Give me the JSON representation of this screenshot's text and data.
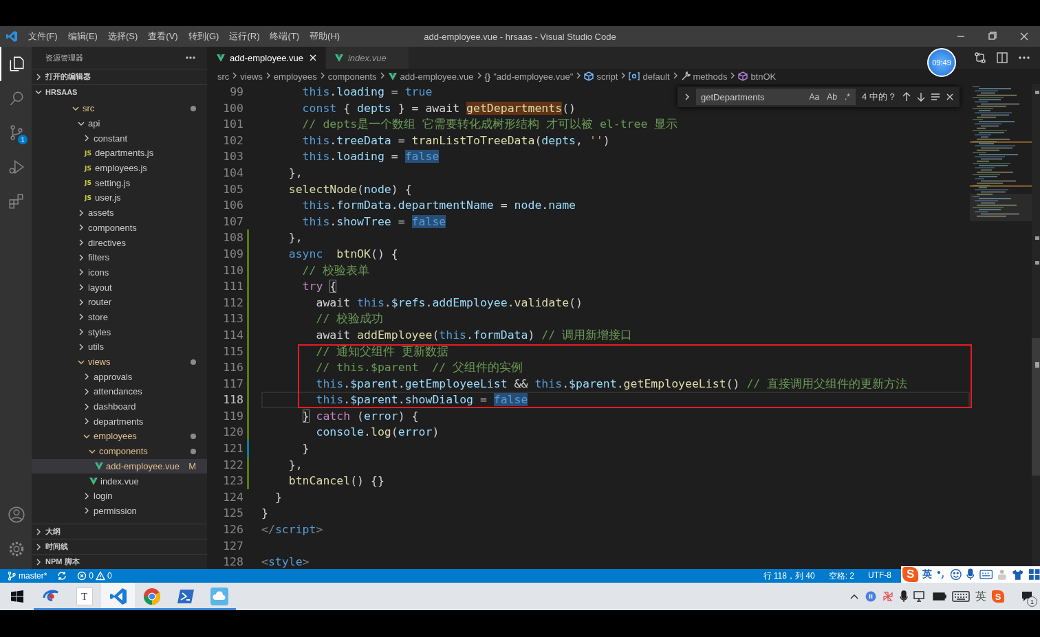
{
  "window": {
    "title": "add-employee.vue - hrsaas - Visual Studio Code",
    "menus": [
      "文件(F)",
      "编辑(E)",
      "选择(S)",
      "查看(V)",
      "转到(G)",
      "运行(R)",
      "终端(T)",
      "帮助(H)"
    ]
  },
  "activity_bar": {
    "items": [
      {
        "kind": "explorer",
        "selected": true
      },
      {
        "kind": "search",
        "selected": false
      },
      {
        "kind": "source-control",
        "selected": false,
        "badge": "1"
      },
      {
        "kind": "run",
        "selected": false
      },
      {
        "kind": "extensions",
        "selected": false
      }
    ],
    "bottom": [
      {
        "kind": "account"
      },
      {
        "kind": "settings"
      }
    ]
  },
  "sidebar": {
    "title": "资源管理器",
    "sections": [
      {
        "label": "打开的编辑器",
        "expanded": false
      },
      {
        "label": "HRSAAS",
        "expanded": true,
        "tree": [
          {
            "label": "src",
            "kind": "folder",
            "expanded": true,
            "selected": false,
            "modified": true,
            "children": [
              {
                "label": "api",
                "kind": "folder",
                "expanded": true,
                "selected": false,
                "modified": false,
                "children": [
                  {
                    "label": "constant",
                    "kind": "folder",
                    "expanded": false,
                    "selected": false,
                    "modified": false
                  },
                  {
                    "label": "departments.js",
                    "kind": "js",
                    "icon_label": "JS",
                    "selected": false,
                    "modified": false
                  },
                  {
                    "label": "employees.js",
                    "kind": "js",
                    "icon_label": "JS",
                    "selected": false,
                    "modified": false
                  },
                  {
                    "label": "setting.js",
                    "kind": "js",
                    "icon_label": "JS",
                    "selected": false,
                    "modified": false
                  },
                  {
                    "label": "user.js",
                    "kind": "js",
                    "icon_label": "JS",
                    "selected": false,
                    "modified": false
                  }
                ]
              },
              {
                "label": "assets",
                "kind": "folder",
                "expanded": false,
                "selected": false,
                "modified": false
              },
              {
                "label": "components",
                "kind": "folder",
                "expanded": false,
                "selected": false,
                "modified": false
              },
              {
                "label": "directives",
                "kind": "folder",
                "expanded": false,
                "selected": false,
                "modified": false
              },
              {
                "label": "filters",
                "kind": "folder",
                "expanded": false,
                "selected": false,
                "modified": false
              },
              {
                "label": "icons",
                "kind": "folder",
                "expanded": false,
                "selected": false,
                "modified": false
              },
              {
                "label": "layout",
                "kind": "folder",
                "expanded": false,
                "selected": false,
                "modified": false
              },
              {
                "label": "router",
                "kind": "folder",
                "expanded": false,
                "selected": false,
                "modified": false
              },
              {
                "label": "store",
                "kind": "folder",
                "expanded": false,
                "selected": false,
                "modified": false
              },
              {
                "label": "styles",
                "kind": "folder",
                "expanded": false,
                "selected": false,
                "modified": false
              },
              {
                "label": "utils",
                "kind": "folder",
                "expanded": false,
                "selected": false,
                "modified": false
              },
              {
                "label": "views",
                "kind": "folder",
                "expanded": true,
                "selected": false,
                "modified": true,
                "children": [
                  {
                    "label": "approvals",
                    "kind": "folder",
                    "expanded": false,
                    "selected": false,
                    "modified": false
                  },
                  {
                    "label": "attendances",
                    "kind": "folder",
                    "expanded": false,
                    "selected": false,
                    "modified": false
                  },
                  {
                    "label": "dashboard",
                    "kind": "folder",
                    "expanded": false,
                    "selected": false,
                    "modified": false
                  },
                  {
                    "label": "departments",
                    "kind": "folder",
                    "expanded": false,
                    "selected": false,
                    "modified": false
                  },
                  {
                    "label": "employees",
                    "kind": "folder",
                    "expanded": true,
                    "selected": false,
                    "modified": true,
                    "children": [
                      {
                        "label": "components",
                        "kind": "folder",
                        "expanded": true,
                        "selected": false,
                        "modified": true,
                        "children": [
                          {
                            "label": "add-employee.vue",
                            "kind": "vue",
                            "selected": true,
                            "modified": true,
                            "badge": "M"
                          }
                        ]
                      },
                      {
                        "label": "index.vue",
                        "kind": "vue",
                        "selected": false,
                        "modified": false
                      }
                    ]
                  },
                  {
                    "label": "login",
                    "kind": "folder",
                    "expanded": false,
                    "selected": false,
                    "modified": false
                  },
                  {
                    "label": "permission",
                    "kind": "folder",
                    "expanded": false,
                    "selected": false,
                    "modified": false
                  }
                ]
              }
            ]
          }
        ]
      },
      {
        "label": "大纲",
        "expanded": false
      },
      {
        "label": "时间线",
        "expanded": false
      },
      {
        "label": "NPM 脚本",
        "expanded": false
      }
    ]
  },
  "tabs": [
    {
      "label": "add-employee.vue",
      "selected": true,
      "preview": false
    },
    {
      "label": "index.vue",
      "selected": false,
      "preview": true
    }
  ],
  "recording_clock": "09:49",
  "breadcrumbs": [
    {
      "label": "src",
      "kind": "folder"
    },
    {
      "label": "views",
      "kind": "folder"
    },
    {
      "label": "employees",
      "kind": "folder"
    },
    {
      "label": "components",
      "kind": "folder"
    },
    {
      "label": "add-employee.vue",
      "kind": "vue"
    },
    {
      "label": "\"add-employee.vue\"",
      "kind": "object",
      "glyph": "{}"
    },
    {
      "label": "script",
      "kind": "script"
    },
    {
      "label": "default",
      "kind": "module"
    },
    {
      "label": "methods",
      "kind": "method"
    },
    {
      "label": "btnOK",
      "kind": "function"
    }
  ],
  "find": {
    "value": "getDepartments",
    "options": [
      {
        "label": "Aa",
        "on": false
      },
      {
        "label": "Ab",
        "on": false
      },
      {
        "label": ".*",
        "on": false
      }
    ],
    "result": "4 中的 ?"
  },
  "editor": {
    "lines": [
      {
        "number": "99",
        "added": false,
        "modified": false,
        "boxed": false,
        "current": false,
        "tokens": [
          {
            "kind": "keyword",
            "text": "      this"
          },
          {
            "kind": "plain",
            "text": "."
          },
          {
            "kind": "variable",
            "text": "loading"
          },
          {
            "kind": "plain",
            "text": " = "
          },
          {
            "kind": "keyword",
            "text": "true"
          }
        ]
      },
      {
        "number": "100",
        "added": false,
        "modified": false,
        "boxed": false,
        "current": false,
        "tokens": [
          {
            "kind": "keyword",
            "text": "      const"
          },
          {
            "kind": "plain",
            "text": " { "
          },
          {
            "kind": "variable",
            "text": "depts"
          },
          {
            "kind": "plain",
            "text": " } = await "
          },
          {
            "kind": "function",
            "text": "getDepartments",
            "find_match": true
          },
          {
            "kind": "plain",
            "text": "()"
          }
        ]
      },
      {
        "number": "101",
        "added": false,
        "modified": false,
        "boxed": false,
        "current": false,
        "tokens": [
          {
            "kind": "comment",
            "text": "      // depts是一个数组 它需要转化成树形结构 才可以被 el-tree 显示"
          }
        ]
      },
      {
        "number": "102",
        "added": false,
        "modified": false,
        "boxed": false,
        "current": false,
        "tokens": [
          {
            "kind": "keyword",
            "text": "      this"
          },
          {
            "kind": "plain",
            "text": "."
          },
          {
            "kind": "variable",
            "text": "treeData"
          },
          {
            "kind": "plain",
            "text": " = "
          },
          {
            "kind": "function",
            "text": "tranListToTreeData"
          },
          {
            "kind": "plain",
            "text": "("
          },
          {
            "kind": "variable",
            "text": "depts"
          },
          {
            "kind": "plain",
            "text": ", "
          },
          {
            "kind": "string",
            "text": "''"
          },
          {
            "kind": "plain",
            "text": ")"
          }
        ]
      },
      {
        "number": "103",
        "added": false,
        "modified": false,
        "boxed": false,
        "current": false,
        "tokens": [
          {
            "kind": "keyword",
            "text": "      this"
          },
          {
            "kind": "plain",
            "text": "."
          },
          {
            "kind": "variable",
            "text": "loading"
          },
          {
            "kind": "plain",
            "text": " = "
          },
          {
            "kind": "keyword",
            "text": "false",
            "occurrence": true
          }
        ]
      },
      {
        "number": "104",
        "added": false,
        "modified": false,
        "boxed": false,
        "current": false,
        "tokens": [
          {
            "kind": "plain",
            "text": "    },"
          }
        ]
      },
      {
        "number": "105",
        "added": false,
        "modified": false,
        "boxed": false,
        "current": false,
        "tokens": [
          {
            "kind": "function",
            "text": "    selectNode"
          },
          {
            "kind": "plain",
            "text": "("
          },
          {
            "kind": "variable",
            "text": "node"
          },
          {
            "kind": "plain",
            "text": ") {"
          }
        ]
      },
      {
        "number": "106",
        "added": false,
        "modified": false,
        "boxed": false,
        "current": false,
        "tokens": [
          {
            "kind": "keyword",
            "text": "      this"
          },
          {
            "kind": "plain",
            "text": "."
          },
          {
            "kind": "variable",
            "text": "formData"
          },
          {
            "kind": "plain",
            "text": "."
          },
          {
            "kind": "variable",
            "text": "departmentName"
          },
          {
            "kind": "plain",
            "text": " = "
          },
          {
            "kind": "variable",
            "text": "node"
          },
          {
            "kind": "plain",
            "text": "."
          },
          {
            "kind": "variable",
            "text": "name"
          }
        ]
      },
      {
        "number": "107",
        "added": false,
        "modified": false,
        "boxed": false,
        "current": false,
        "tokens": [
          {
            "kind": "keyword",
            "text": "      this"
          },
          {
            "kind": "plain",
            "text": "."
          },
          {
            "kind": "variable",
            "text": "showTree"
          },
          {
            "kind": "plain",
            "text": " = "
          },
          {
            "kind": "keyword",
            "text": "false",
            "occurrence": true
          }
        ]
      },
      {
        "number": "108",
        "added": true,
        "modified": false,
        "boxed": false,
        "current": false,
        "tokens": [
          {
            "kind": "plain",
            "text": "    },"
          }
        ]
      },
      {
        "number": "109",
        "added": true,
        "modified": false,
        "boxed": false,
        "current": false,
        "tokens": [
          {
            "kind": "keyword",
            "text": "    async  "
          },
          {
            "kind": "function",
            "text": "btnOK"
          },
          {
            "kind": "plain",
            "text": "() {"
          }
        ]
      },
      {
        "number": "110",
        "added": true,
        "modified": false,
        "boxed": false,
        "current": false,
        "tokens": [
          {
            "kind": "comment",
            "text": "      // 校验表单"
          }
        ]
      },
      {
        "number": "111",
        "added": true,
        "modified": false,
        "boxed": false,
        "current": false,
        "tokens": [
          {
            "kind": "control",
            "text": "      try "
          },
          {
            "kind": "plain",
            "text": "{",
            "bracket_match": true
          }
        ]
      },
      {
        "number": "112",
        "added": true,
        "modified": false,
        "boxed": false,
        "current": false,
        "tokens": [
          {
            "kind": "plain",
            "text": "        await "
          },
          {
            "kind": "keyword",
            "text": "this"
          },
          {
            "kind": "plain",
            "text": "."
          },
          {
            "kind": "variable",
            "text": "$refs"
          },
          {
            "kind": "plain",
            "text": "."
          },
          {
            "kind": "variable",
            "text": "addEmployee"
          },
          {
            "kind": "plain",
            "text": "."
          },
          {
            "kind": "function",
            "text": "validate"
          },
          {
            "kind": "plain",
            "text": "()"
          }
        ]
      },
      {
        "number": "113",
        "added": true,
        "modified": false,
        "boxed": false,
        "current": false,
        "tokens": [
          {
            "kind": "comment",
            "text": "        // 校验成功"
          }
        ]
      },
      {
        "number": "114",
        "added": true,
        "modified": false,
        "boxed": false,
        "current": false,
        "tokens": [
          {
            "kind": "plain",
            "text": "        await "
          },
          {
            "kind": "function",
            "text": "addEmployee"
          },
          {
            "kind": "plain",
            "text": "("
          },
          {
            "kind": "keyword",
            "text": "this"
          },
          {
            "kind": "plain",
            "text": "."
          },
          {
            "kind": "variable",
            "text": "formData"
          },
          {
            "kind": "plain",
            "text": ") "
          },
          {
            "kind": "comment",
            "text": "// 调用新增接口"
          }
        ]
      },
      {
        "number": "115",
        "added": true,
        "modified": false,
        "boxed": true,
        "current": false,
        "tokens": [
          {
            "kind": "comment",
            "text": "        // 通知父组件 更新数据"
          }
        ]
      },
      {
        "number": "116",
        "added": true,
        "modified": false,
        "boxed": true,
        "current": false,
        "tokens": [
          {
            "kind": "comment",
            "text": "        // this.$parent  // 父组件的实例"
          }
        ]
      },
      {
        "number": "117",
        "added": true,
        "modified": false,
        "boxed": true,
        "current": false,
        "tokens": [
          {
            "kind": "keyword",
            "text": "        this"
          },
          {
            "kind": "plain",
            "text": "."
          },
          {
            "kind": "variable",
            "text": "$parent"
          },
          {
            "kind": "plain",
            "text": "."
          },
          {
            "kind": "variable",
            "text": "getEmployeeList"
          },
          {
            "kind": "plain",
            "text": " && "
          },
          {
            "kind": "keyword",
            "text": "this"
          },
          {
            "kind": "plain",
            "text": "."
          },
          {
            "kind": "variable",
            "text": "$parent"
          },
          {
            "kind": "plain",
            "text": "."
          },
          {
            "kind": "function",
            "text": "getEmployeeList"
          },
          {
            "kind": "plain",
            "text": "() "
          },
          {
            "kind": "comment",
            "text": "// 直接调用父组件的更新方法"
          }
        ]
      },
      {
        "number": "118",
        "added": true,
        "modified": false,
        "boxed": true,
        "current": true,
        "tokens": [
          {
            "kind": "keyword",
            "text": "        this"
          },
          {
            "kind": "plain",
            "text": "."
          },
          {
            "kind": "variable",
            "text": "$parent"
          },
          {
            "kind": "plain",
            "text": "."
          },
          {
            "kind": "variable",
            "text": "showDialog"
          },
          {
            "kind": "plain",
            "text": " = "
          },
          {
            "kind": "keyword",
            "text": "false",
            "occurrence": true
          }
        ]
      },
      {
        "number": "119",
        "added": true,
        "modified": false,
        "boxed": false,
        "current": false,
        "tokens": [
          {
            "kind": "plain",
            "text": "      }",
            "bracket_match": true
          },
          {
            "kind": "control",
            "text": " catch"
          },
          {
            "kind": "plain",
            "text": " ("
          },
          {
            "kind": "variable",
            "text": "error"
          },
          {
            "kind": "plain",
            "text": ") {"
          }
        ]
      },
      {
        "number": "120",
        "added": true,
        "modified": false,
        "boxed": false,
        "current": false,
        "tokens": [
          {
            "kind": "variable",
            "text": "        console"
          },
          {
            "kind": "plain",
            "text": "."
          },
          {
            "kind": "function",
            "text": "log"
          },
          {
            "kind": "plain",
            "text": "("
          },
          {
            "kind": "variable",
            "text": "error"
          },
          {
            "kind": "plain",
            "text": ")"
          }
        ]
      },
      {
        "number": "121",
        "added": false,
        "modified": true,
        "boxed": false,
        "current": false,
        "tokens": [
          {
            "kind": "plain",
            "text": "      }"
          }
        ]
      },
      {
        "number": "122",
        "added": true,
        "modified": false,
        "boxed": false,
        "current": false,
        "tokens": [
          {
            "kind": "plain",
            "text": "    },"
          }
        ]
      },
      {
        "number": "123",
        "added": true,
        "modified": false,
        "boxed": false,
        "current": false,
        "tokens": [
          {
            "kind": "function",
            "text": "    btnCancel"
          },
          {
            "kind": "plain",
            "text": "() {}"
          }
        ]
      },
      {
        "number": "124",
        "added": false,
        "modified": false,
        "boxed": false,
        "current": false,
        "tokens": [
          {
            "kind": "plain",
            "text": "  }"
          }
        ]
      },
      {
        "number": "125",
        "added": false,
        "modified": false,
        "boxed": false,
        "current": false,
        "tokens": [
          {
            "kind": "plain",
            "text": "}"
          }
        ]
      },
      {
        "number": "126",
        "added": false,
        "modified": false,
        "boxed": false,
        "current": false,
        "tokens": [
          {
            "kind": "tag-punctuation",
            "text": "</"
          },
          {
            "kind": "tag",
            "text": "script"
          },
          {
            "kind": "tag-punctuation",
            "text": ">"
          }
        ]
      },
      {
        "number": "127",
        "added": false,
        "modified": false,
        "boxed": false,
        "current": false
      },
      {
        "number": "128",
        "added": false,
        "modified": false,
        "boxed": false,
        "current": false,
        "tokens": [
          {
            "kind": "tag-punctuation",
            "text": "<"
          },
          {
            "kind": "tag",
            "text": "style"
          },
          {
            "kind": "tag-punctuation",
            "text": ">"
          }
        ]
      }
    ]
  },
  "status_bar": {
    "branch": "master*",
    "errors": "0",
    "warnings": "0",
    "position": "行 118，列 40",
    "indent": "空格: 2",
    "encoding": "UTF-8"
  },
  "ime_bar": {
    "logo": "S",
    "mode": "英"
  },
  "taskbar": {
    "apps": [
      {
        "kind": "swirl",
        "running": true,
        "active": false
      },
      {
        "kind": "text-editor",
        "label": "T",
        "running": true,
        "active": false
      },
      {
        "kind": "vscode",
        "running": true,
        "active": true
      },
      {
        "kind": "chrome",
        "running": true,
        "active": false
      },
      {
        "kind": "terminal",
        "running": true,
        "active": false
      },
      {
        "kind": "cloud",
        "running": true,
        "active": false
      }
    ],
    "tray": {
      "language": "英",
      "ime_logo": "S",
      "notifications": "1"
    }
  }
}
